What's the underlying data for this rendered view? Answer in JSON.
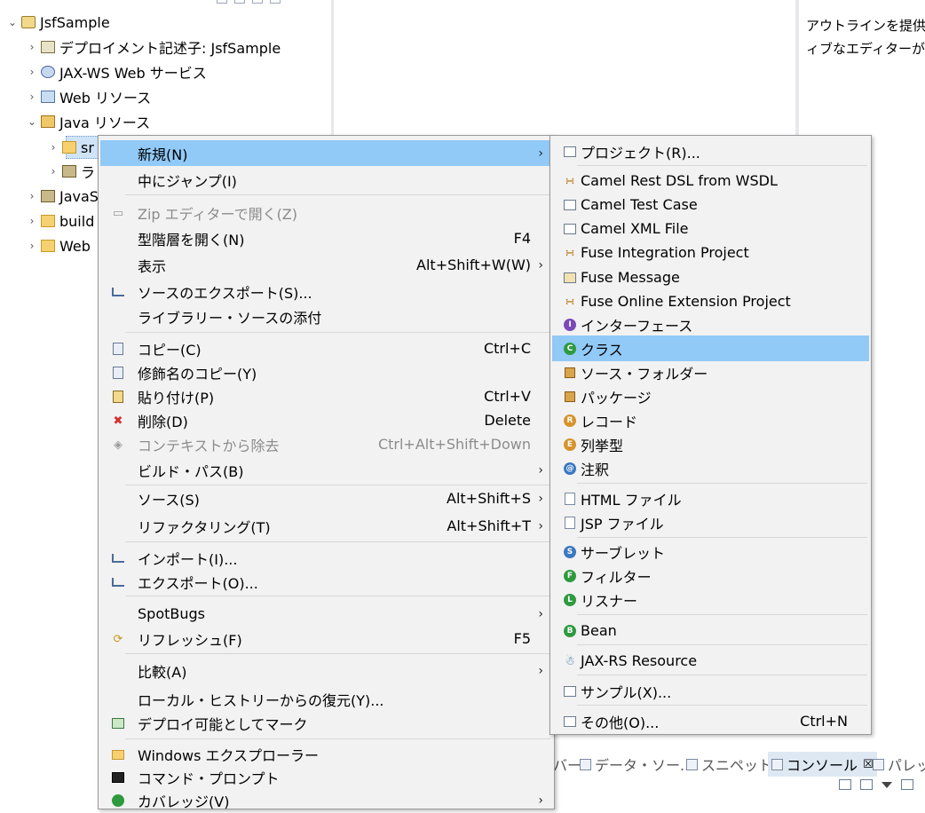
{
  "tree": {
    "project": "JsfSample",
    "items": [
      {
        "label": "デプロイメント記述子: JsfSample"
      },
      {
        "label": "JAX-WS Web サービス"
      },
      {
        "label": "Web リソース"
      },
      {
        "label": "Java リソース"
      },
      {
        "label": "sr"
      },
      {
        "label": "ラ"
      },
      {
        "label": "JavaS"
      },
      {
        "label": "build"
      },
      {
        "label": "Web"
      }
    ]
  },
  "outline": {
    "line1": "アウトラインを提供す",
    "line2": "ィブなエディターがあ"
  },
  "context_menu": {
    "items": [
      {
        "label": "新規(N)",
        "accel": "",
        "submenu": true,
        "icon": "none"
      },
      {
        "label": "中にジャンプ(I)",
        "accel": "",
        "icon": "none"
      },
      {
        "label": "Zip エディターで開く(Z)",
        "accel": "",
        "icon": "zip-icon"
      },
      {
        "label": "型階層を開く(N)",
        "accel": "F4",
        "icon": "none"
      },
      {
        "label": "表示",
        "accel": "Alt+Shift+W(W)",
        "submenu": true,
        "icon": "none"
      },
      {
        "label": "ソースのエクスポート(S)...",
        "accel": "",
        "icon": "export-icon"
      },
      {
        "label": "ライブラリー・ソースの添付",
        "accel": "",
        "icon": "none"
      },
      {
        "label": "コピー(C)",
        "accel": "Ctrl+C",
        "icon": "copy-icon"
      },
      {
        "label": "修飾名のコピー(Y)",
        "accel": "",
        "icon": "copy-qualified-icon"
      },
      {
        "label": "貼り付け(P)",
        "accel": "Ctrl+V",
        "icon": "paste-icon"
      },
      {
        "label": "削除(D)",
        "accel": "Delete",
        "icon": "delete-icon"
      },
      {
        "label": "コンテキストから除去",
        "accel": "Ctrl+Alt+Shift+Down",
        "icon": "remove-context-icon"
      },
      {
        "label": "ビルド・パス(B)",
        "accel": "",
        "submenu": true,
        "icon": "none"
      },
      {
        "label": "ソース(S)",
        "accel": "Alt+Shift+S",
        "submenu": true,
        "icon": "none"
      },
      {
        "label": "リファクタリング(T)",
        "accel": "Alt+Shift+T",
        "submenu": true,
        "icon": "none"
      },
      {
        "label": "インポート(I)...",
        "accel": "",
        "icon": "import-icon"
      },
      {
        "label": "エクスポート(O)...",
        "accel": "",
        "icon": "export-icon"
      },
      {
        "label": "SpotBugs",
        "accel": "",
        "submenu": true,
        "icon": "none"
      },
      {
        "label": "リフレッシュ(F)",
        "accel": "F5",
        "icon": "refresh-icon"
      },
      {
        "label": "比較(A)",
        "accel": "",
        "submenu": true,
        "icon": "none"
      },
      {
        "label": "ローカル・ヒストリーからの復元(Y)...",
        "accel": "",
        "icon": "none"
      },
      {
        "label": "デプロイ可能としてマーク",
        "accel": "",
        "icon": "deploy-icon"
      },
      {
        "label": "Windows エクスプローラー",
        "accel": "",
        "icon": "explorer-icon"
      },
      {
        "label": "コマンド・プロンプト",
        "accel": "",
        "icon": "console-icon"
      },
      {
        "label": "カバレッジ(V)",
        "accel": "",
        "submenu": true,
        "icon": "coverage-icon"
      }
    ]
  },
  "new_submenu": {
    "items": [
      {
        "label": "プロジェクト(R)...",
        "accel": "",
        "icon": "project-icon"
      },
      {
        "label": "Camel Rest DSL from WSDL",
        "accel": "",
        "icon": "camel-icon"
      },
      {
        "label": "Camel Test Case",
        "accel": "",
        "icon": "test-case-icon"
      },
      {
        "label": "Camel XML File",
        "accel": "",
        "icon": "xml-file-icon"
      },
      {
        "label": "Fuse Integration Project",
        "accel": "",
        "icon": "camel-icon"
      },
      {
        "label": "Fuse Message",
        "accel": "",
        "icon": "message-icon"
      },
      {
        "label": "Fuse Online Extension Project",
        "accel": "",
        "icon": "camel-icon"
      },
      {
        "label": "インターフェース",
        "accel": "",
        "icon": "interface-icon"
      },
      {
        "label": "クラス",
        "accel": "",
        "icon": "class-icon"
      },
      {
        "label": "ソース・フォルダー",
        "accel": "",
        "icon": "source-folder-icon"
      },
      {
        "label": "パッケージ",
        "accel": "",
        "icon": "package-icon"
      },
      {
        "label": "レコード",
        "accel": "",
        "icon": "record-icon"
      },
      {
        "label": "列挙型",
        "accel": "",
        "icon": "enum-icon"
      },
      {
        "label": "注釈",
        "accel": "",
        "icon": "annotation-icon"
      },
      {
        "label": "HTML ファイル",
        "accel": "",
        "icon": "html-file-icon"
      },
      {
        "label": "JSP ファイル",
        "accel": "",
        "icon": "jsp-file-icon"
      },
      {
        "label": "サーブレット",
        "accel": "",
        "icon": "servlet-icon"
      },
      {
        "label": "フィルター",
        "accel": "",
        "icon": "filter-icon"
      },
      {
        "label": "リスナー",
        "accel": "",
        "icon": "listener-icon"
      },
      {
        "label": "Bean",
        "accel": "",
        "icon": "bean-icon"
      },
      {
        "label": "JAX-RS Resource",
        "accel": "",
        "icon": "jaxrs-icon"
      },
      {
        "label": "サンプル(X)...",
        "accel": "",
        "icon": "sample-icon"
      },
      {
        "label": "その他(O)...",
        "accel": "Ctrl+N",
        "icon": "other-icon"
      }
    ]
  },
  "bottom_tabs": [
    {
      "label": "バー"
    },
    {
      "label": "データ・ソー..."
    },
    {
      "label": "スニペット"
    },
    {
      "label": "コンソール",
      "close": "☒"
    },
    {
      "label": "パレッ"
    }
  ],
  "colors": {
    "menu_bg": "#f2f2f2",
    "highlight": "#91c9f7",
    "disabled_text": "#8c8c8c"
  }
}
